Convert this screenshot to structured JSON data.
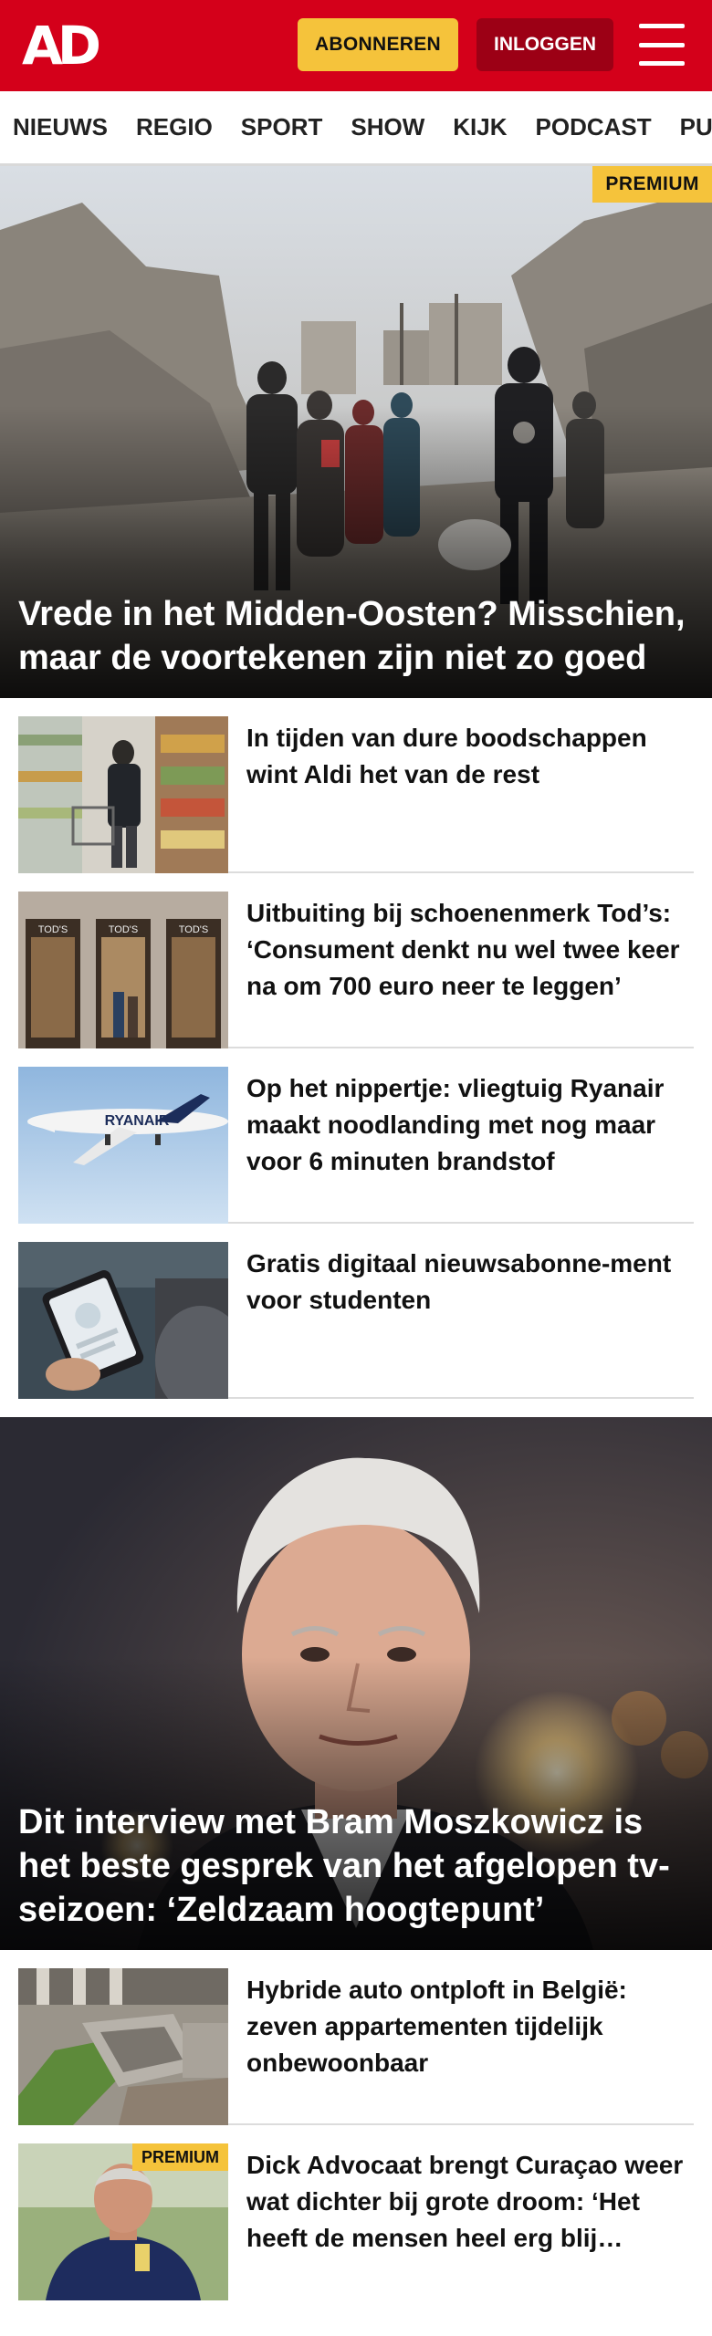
{
  "header": {
    "logo": "AD",
    "subscribe_label": "ABONNEREN",
    "login_label": "INLOGGEN"
  },
  "nav": {
    "items": [
      "NIEUWS",
      "REGIO",
      "SPORT",
      "SHOW",
      "KIJK",
      "PODCAST",
      "PUZZ"
    ]
  },
  "hero": {
    "badge": "PREMIUM",
    "title": "Vrede in het Midden-Oosten? Misschien, maar de voortekenen zijn niet zo goed"
  },
  "articles_1": [
    {
      "title": "In tijden van dure boodschappen wint Aldi het van de rest"
    },
    {
      "title": "Uitbuiting bij schoenenmerk Tod’s: ‘Consument denkt nu wel twee keer na om 700 euro neer te leggen’"
    },
    {
      "title": "Op het nippertje: vliegtuig Ryanair maakt noodlanding met nog maar voor 6 minuten brandstof"
    },
    {
      "title": "Gratis digitaal nieuwsabonne-ment voor studenten"
    }
  ],
  "hero2": {
    "title": "Dit interview met Bram Moszkowicz is het beste gesprek van het afgelopen tv-seizoen: ‘Zeldzaam hoogtepunt’"
  },
  "articles_2": [
    {
      "title": "Hybride auto ontploft in België: zeven appartementen tijdelijk onbewoonbaar"
    },
    {
      "title": "Dick Advocaat brengt Curaçao weer wat dichter bij grote droom: ‘Het heeft de mensen heel erg blij gemaakt’",
      "badge": "PREMIUM"
    }
  ],
  "thumb_text": {
    "tods": "TOD'S",
    "ryanair": "RYANAIR"
  },
  "colors": {
    "brand_red": "#d4001a",
    "login_red": "#9c0015",
    "premium_yellow": "#f5c33b"
  }
}
